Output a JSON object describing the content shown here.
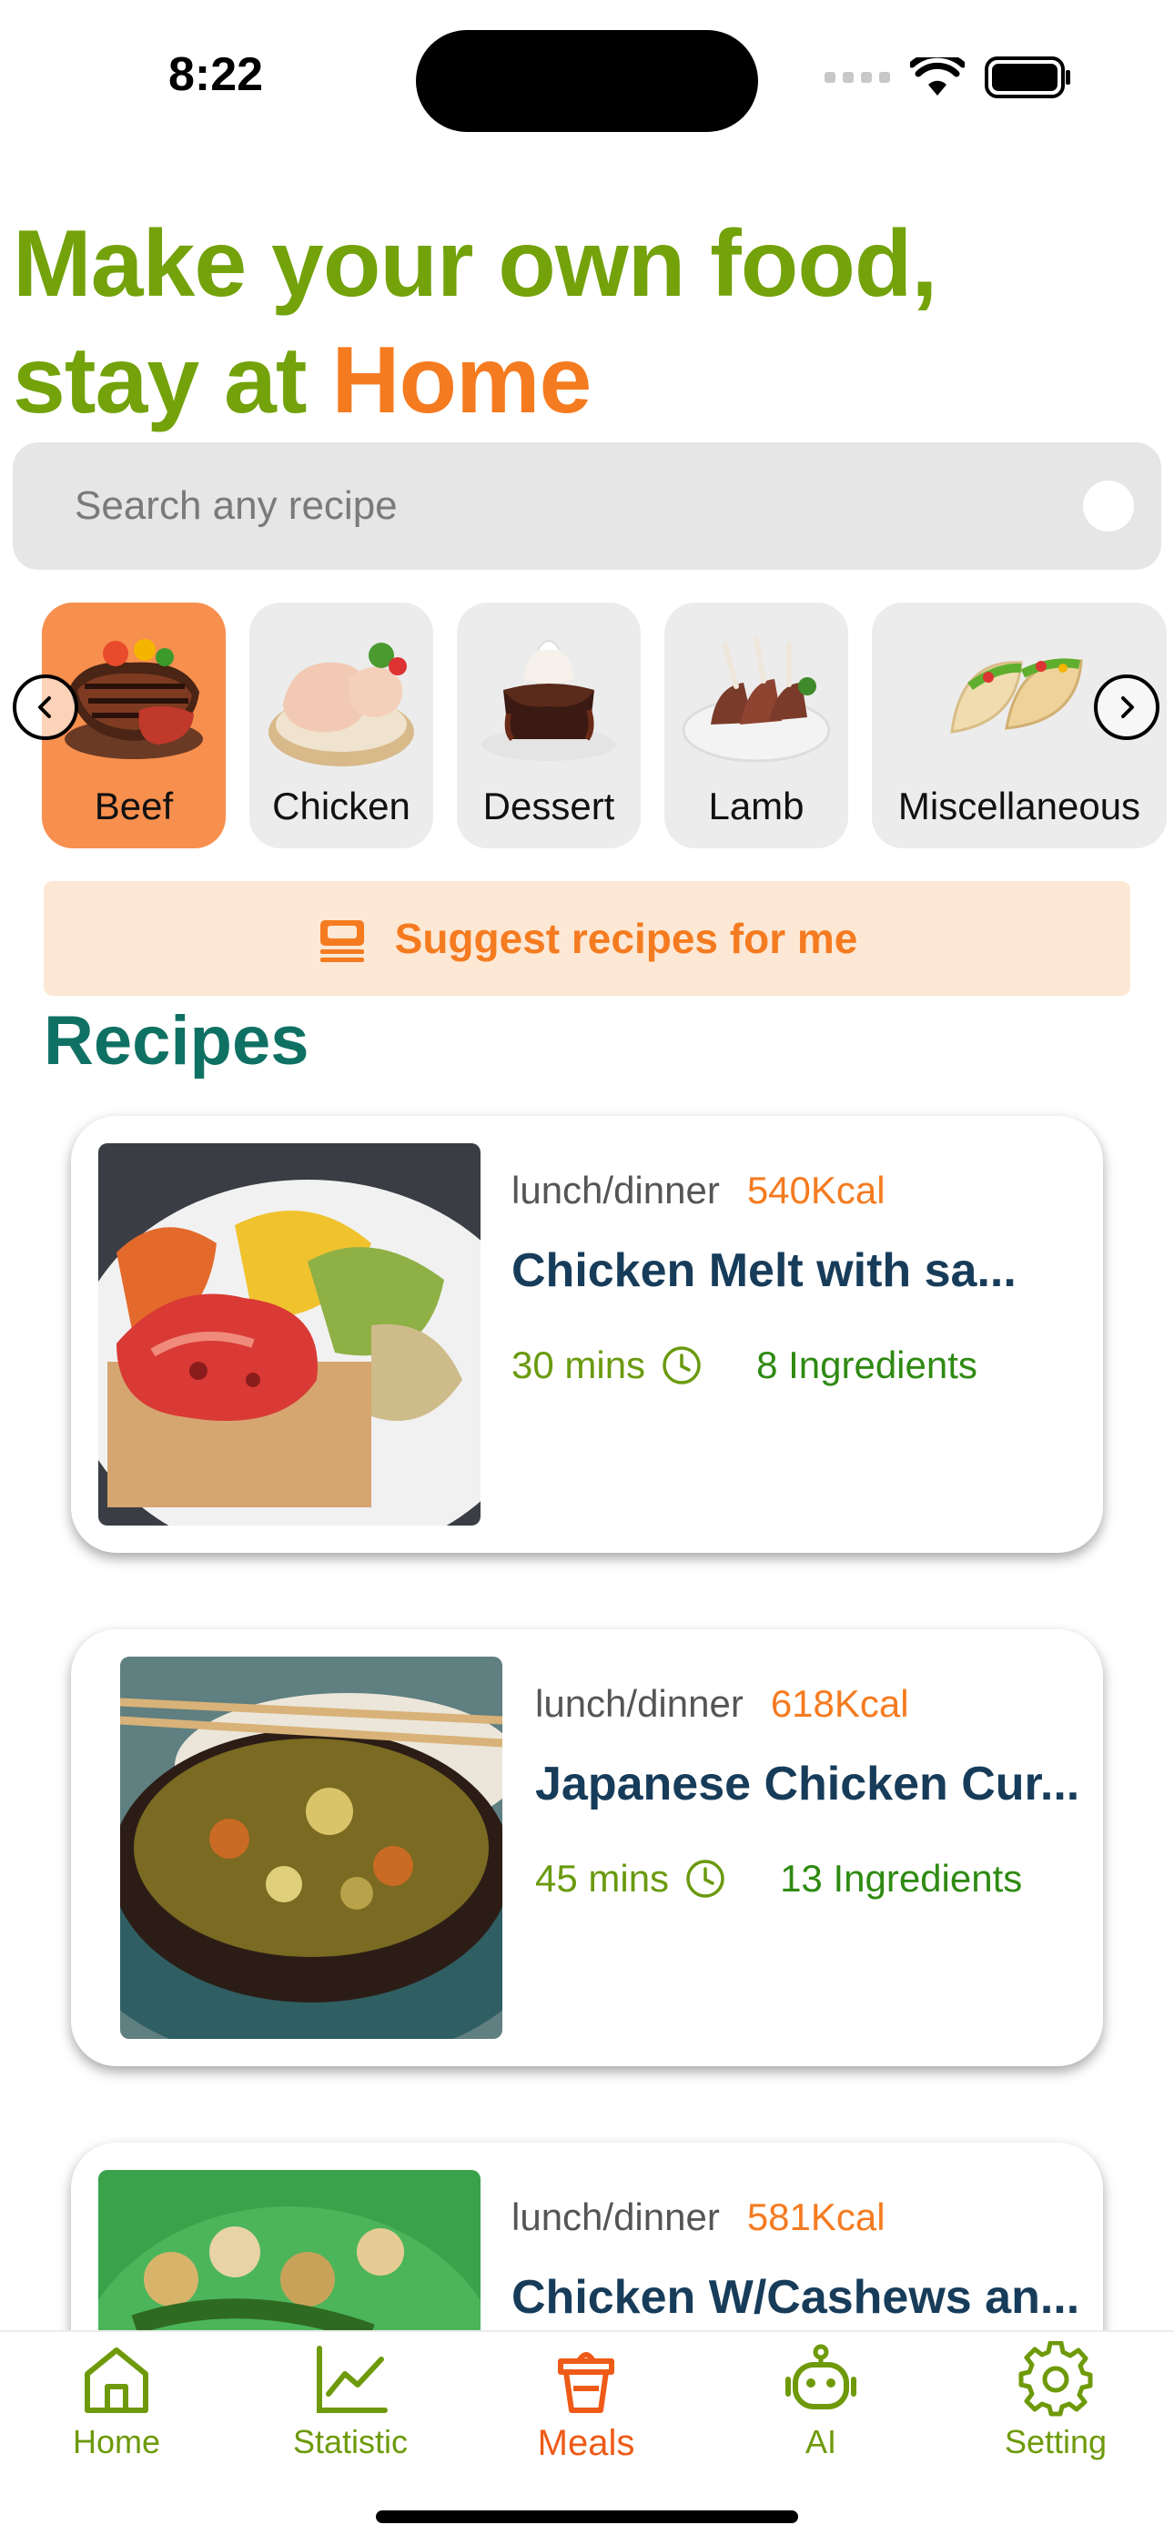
{
  "status_bar": {
    "time": "8:22"
  },
  "headline": {
    "line1": "Make your own food,",
    "line2_prefix": "stay at ",
    "line2_accent": "Home"
  },
  "search": {
    "placeholder": "Search any recipe",
    "value": ""
  },
  "categories": [
    {
      "label": "Beef",
      "active": true
    },
    {
      "label": "Chicken",
      "active": false
    },
    {
      "label": "Dessert",
      "active": false
    },
    {
      "label": "Lamb",
      "active": false
    },
    {
      "label": "Miscellaneous",
      "active": false
    }
  ],
  "suggest": {
    "label": "Suggest recipes for me"
  },
  "section_title": "Recipes",
  "recipes": [
    {
      "category": "lunch/dinner",
      "kcal": "540Kcal",
      "name": "Chicken Melt with sa...",
      "time": "30 mins",
      "ingredients": "8 Ingredients"
    },
    {
      "category": "lunch/dinner",
      "kcal": "618Kcal",
      "name": "Japanese Chicken Cur...",
      "time": "45 mins",
      "ingredients": "13 Ingredients"
    },
    {
      "category": "lunch/dinner",
      "kcal": "581Kcal",
      "name": "Chicken W/Cashews an...",
      "time": "",
      "ingredients": ""
    }
  ],
  "tabs": [
    {
      "label": "Home",
      "icon": "home-icon",
      "active": false
    },
    {
      "label": "Statistic",
      "icon": "chart-icon",
      "active": false
    },
    {
      "label": "Meals",
      "icon": "meals-icon",
      "active": true
    },
    {
      "label": "AI",
      "icon": "robot-icon",
      "active": false
    },
    {
      "label": "Setting",
      "icon": "gear-icon",
      "active": false
    }
  ],
  "colors": {
    "brand_green": "#73a20a",
    "accent_orange": "#f57b20",
    "title_teal": "#0f7163",
    "recipe_name_navy": "#173c5a"
  }
}
